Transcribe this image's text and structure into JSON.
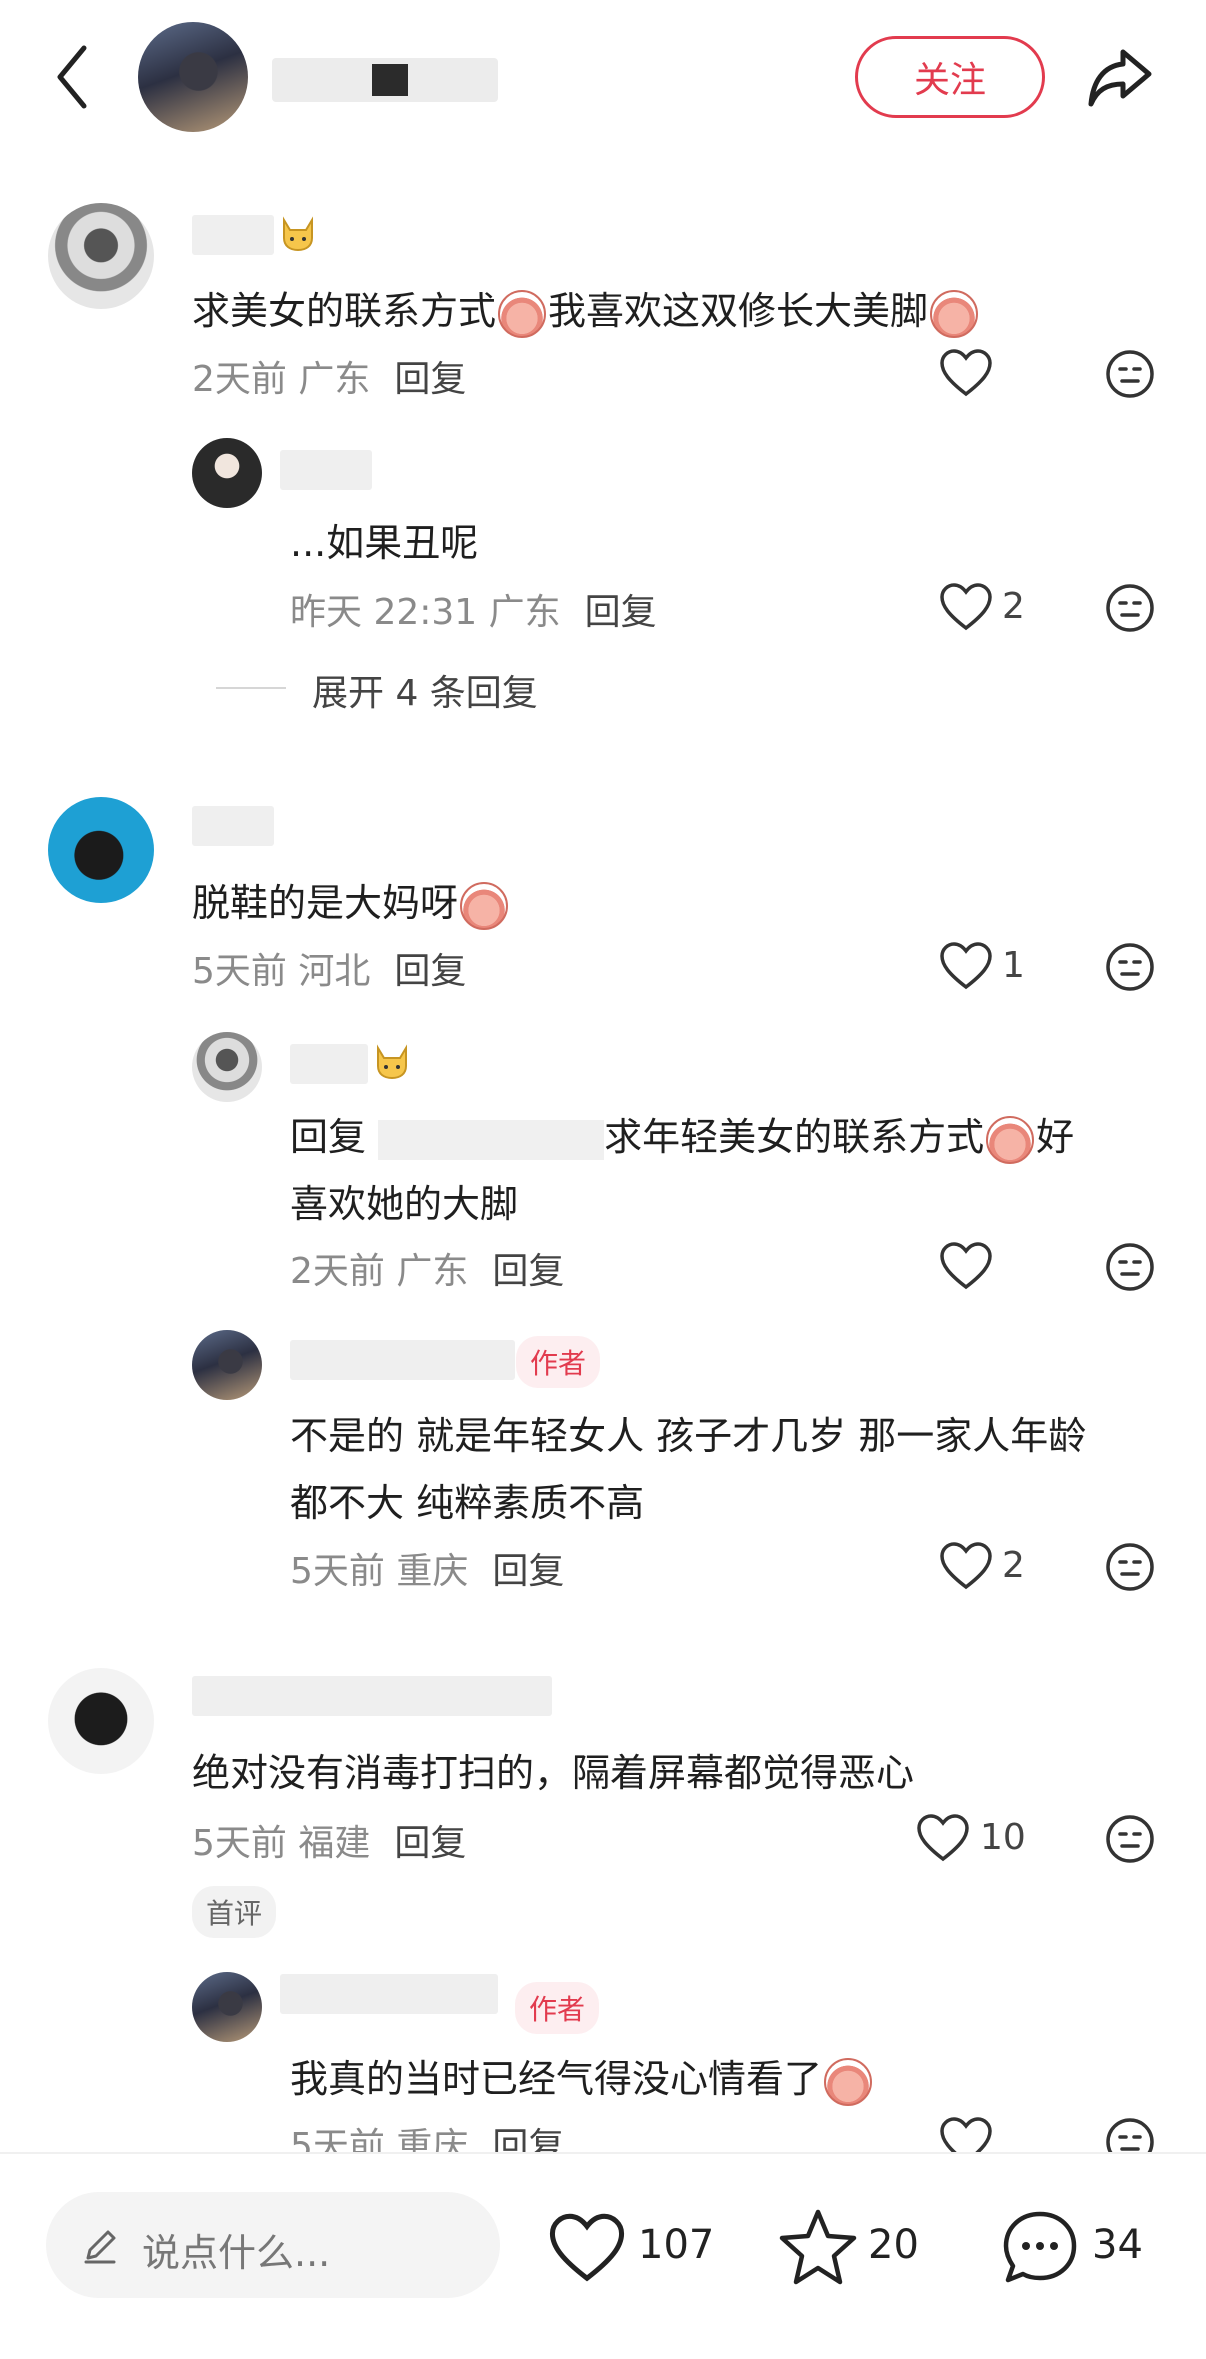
{
  "header": {
    "follow_label": "关注"
  },
  "comments": [
    {
      "text": "求美女的联系方式",
      "text2": "我喜欢这双修长大美脚",
      "time": "2天前",
      "region": "广东",
      "reply": "回复",
      "likes": ""
    },
    {
      "text": "...如果丑呢",
      "time": "昨天 22:31",
      "region": "广东",
      "reply": "回复",
      "likes": "2"
    },
    {
      "expand": "展开 4 条回复"
    },
    {
      "text": "脱鞋的是大妈呀",
      "time": "5天前",
      "region": "河北",
      "reply": "回复",
      "likes": "1"
    },
    {
      "text_line1_a": "回复 ",
      "text_line1_b": "求年轻美女的联系方式",
      "text_line1_c": "好",
      "text_line2": "喜欢她的大脚",
      "time": "2天前",
      "region": "广东",
      "reply": "回复",
      "likes": ""
    },
    {
      "badge": "作者",
      "text_line1": "不是的 就是年轻女人 孩子才几岁 那一家人年龄",
      "text_line2": "都不大 纯粹素质不高",
      "time": "5天前",
      "region": "重庆",
      "reply": "回复",
      "likes": "2"
    },
    {
      "text": "绝对没有消毒打扫的，隔着屏幕都觉得恶心",
      "time": "5天前",
      "region": "福建",
      "reply": "回复",
      "likes": "10",
      "badge": "首评"
    },
    {
      "badge": "作者",
      "text": "我真的当时已经气得没心情看了",
      "time": "5天前",
      "region": "重庆",
      "reply": "回复",
      "likes": ""
    }
  ],
  "bottom": {
    "placeholder": "说点什么...",
    "likes": "107",
    "stars": "20",
    "comments": "34"
  }
}
